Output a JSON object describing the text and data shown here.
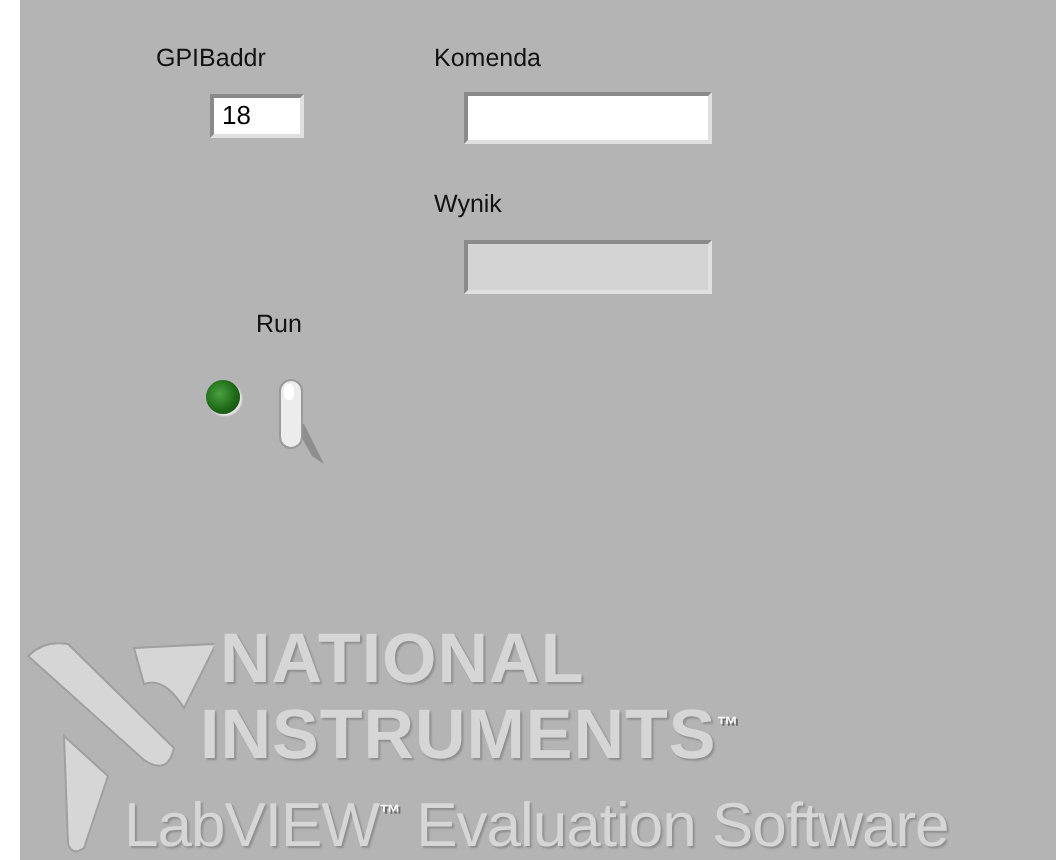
{
  "controls": [
    {
      "kind": "numeric",
      "label": "GPIBaddr",
      "value": "18"
    },
    {
      "kind": "string",
      "label": "Komenda"
    },
    {
      "kind": "indicator",
      "label": "Wynik"
    }
  ],
  "run": {
    "label": "Run",
    "led_on": false,
    "switch_on": true
  },
  "watermark": {
    "lines": [
      "NATIONAL",
      "INSTRUMENTS$^{™}$",
      "LabVIEW$^{™}$ Evaluation Software"
    ]
  }
}
